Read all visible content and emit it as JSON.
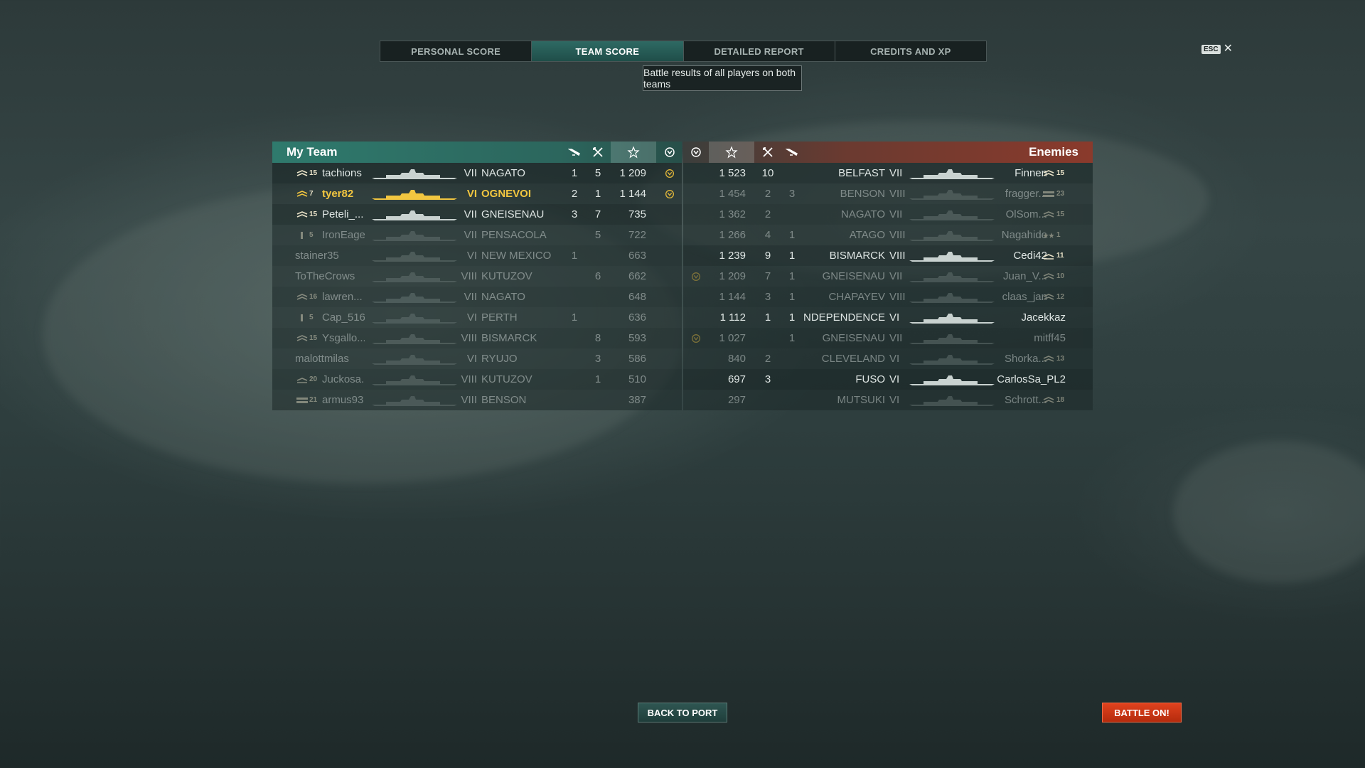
{
  "tabs": [
    {
      "label": "PERSONAL SCORE",
      "active": false
    },
    {
      "label": "TEAM SCORE",
      "active": true
    },
    {
      "label": "DETAILED REPORT",
      "active": false
    },
    {
      "label": "CREDITS AND XP",
      "active": false
    }
  ],
  "tooltip": "Battle results of all players on both teams",
  "esc": {
    "key": "ESC",
    "close": "✕"
  },
  "my_team": {
    "title": "My Team",
    "columns": [
      "plane-kills-icon",
      "ship-kills-icon",
      "star-icon",
      "survived-icon"
    ],
    "rows": [
      {
        "rank": "15",
        "rank_icon": "chevrons-2",
        "name": "tachions",
        "tier": "VII",
        "ship": "NAGATO",
        "planes": "1",
        "kills": "5",
        "xp": "1 209",
        "survived": true,
        "self": false,
        "dead": false
      },
      {
        "rank": "7",
        "rank_icon": "chevrons-2",
        "name": "tyer82",
        "tier": "VI",
        "ship": "OGNEVOI",
        "planes": "2",
        "kills": "1",
        "xp": "1 144",
        "survived": true,
        "self": true,
        "dead": false
      },
      {
        "rank": "15",
        "rank_icon": "chevrons-2",
        "name": "Peteli_...",
        "tier": "VII",
        "ship": "GNEISENAU",
        "planes": "3",
        "kills": "7",
        "xp": "735",
        "survived": false,
        "self": false,
        "dead": false
      },
      {
        "rank": "5",
        "rank_icon": "bar",
        "name": "IronEagel",
        "tier": "VII",
        "ship": "PENSACOLA",
        "planes": "",
        "kills": "5",
        "xp": "722",
        "survived": false,
        "self": false,
        "dead": true
      },
      {
        "rank": "",
        "rank_icon": "",
        "name": "stainer35",
        "tier": "VI",
        "ship": "NEW MEXICO",
        "planes": "1",
        "kills": "",
        "xp": "663",
        "survived": false,
        "self": false,
        "dead": true
      },
      {
        "rank": "",
        "rank_icon": "",
        "name": "ToTheCrows",
        "tier": "VIII",
        "ship": "KUTUZOV",
        "planes": "",
        "kills": "6",
        "xp": "662",
        "survived": false,
        "self": false,
        "dead": true
      },
      {
        "rank": "16",
        "rank_icon": "chevrons-2",
        "name": "lawren...",
        "tier": "VII",
        "ship": "NAGATO",
        "planes": "",
        "kills": "",
        "xp": "648",
        "survived": false,
        "self": false,
        "dead": true
      },
      {
        "rank": "5",
        "rank_icon": "bar",
        "name": "Cap_516",
        "tier": "VI",
        "ship": "PERTH",
        "planes": "1",
        "kills": "",
        "xp": "636",
        "survived": false,
        "self": false,
        "dead": true
      },
      {
        "rank": "15",
        "rank_icon": "chevrons-2",
        "name": "Ysgallo...",
        "tier": "VIII",
        "ship": "BISMARCK",
        "planes": "",
        "kills": "8",
        "xp": "593",
        "survived": false,
        "self": false,
        "dead": true
      },
      {
        "rank": "",
        "rank_icon": "",
        "name": "malottmilas",
        "tier": "VI",
        "ship": "RYUJO",
        "planes": "",
        "kills": "3",
        "xp": "586",
        "survived": false,
        "self": false,
        "dead": true
      },
      {
        "rank": "20",
        "rank_icon": "chevron-1",
        "name": "Juckosa...",
        "tier": "VIII",
        "ship": "KUTUZOV",
        "planes": "",
        "kills": "1",
        "xp": "510",
        "survived": false,
        "self": false,
        "dead": true
      },
      {
        "rank": "21",
        "rank_icon": "bars",
        "name": "armus93",
        "tier": "VIII",
        "ship": "BENSON",
        "planes": "",
        "kills": "",
        "xp": "387",
        "survived": false,
        "self": false,
        "dead": true
      }
    ]
  },
  "enemies": {
    "title": "Enemies",
    "columns": [
      "survived-icon",
      "star-icon",
      "ship-kills-icon",
      "plane-kills-icon"
    ],
    "rows": [
      {
        "survived": false,
        "xp": "1 523",
        "kills": "10",
        "planes": "",
        "ship": "BELFAST",
        "tier": "VII",
        "name": "Finnen",
        "rank": "15",
        "rank_icon": "chevrons-2",
        "dead": false
      },
      {
        "survived": false,
        "xp": "1 454",
        "kills": "2",
        "planes": "3",
        "ship": "BENSON",
        "tier": "VIII",
        "name": "fragger...",
        "rank": "23",
        "rank_icon": "bars",
        "dead": true
      },
      {
        "survived": false,
        "xp": "1 362",
        "kills": "2",
        "planes": "",
        "ship": "NAGATO",
        "tier": "VII",
        "name": "OlSom...",
        "rank": "15",
        "rank_icon": "chevrons-2",
        "dead": true
      },
      {
        "survived": false,
        "xp": "1 266",
        "kills": "4",
        "planes": "1",
        "ship": "ATAGO",
        "tier": "VIII",
        "name": "Nagahide",
        "rank": "1",
        "rank_icon": "stars",
        "dead": true
      },
      {
        "survived": false,
        "xp": "1 239",
        "kills": "9",
        "planes": "1",
        "ship": "BISMARCK",
        "tier": "VIII",
        "name": "Cedi42",
        "rank": "11",
        "rank_icon": "chevron-1",
        "dead": false
      },
      {
        "survived": true,
        "xp": "1 209",
        "kills": "7",
        "planes": "1",
        "ship": "GNEISENAU",
        "tier": "VII",
        "name": "Juan_V...",
        "rank": "10",
        "rank_icon": "chevrons-2",
        "dead": true
      },
      {
        "survived": false,
        "xp": "1 144",
        "kills": "3",
        "planes": "1",
        "ship": "CHAPAYEV",
        "tier": "VIII",
        "name": "claas_jan",
        "rank": "12",
        "rank_icon": "chevrons-2",
        "dead": true
      },
      {
        "survived": false,
        "xp": "1 112",
        "kills": "1",
        "planes": "1",
        "ship": "INDEPENDENCE",
        "tier": "VI",
        "name": "Jacekkaz",
        "rank": "",
        "rank_icon": "",
        "dead": false
      },
      {
        "survived": true,
        "xp": "1 027",
        "kills": "",
        "planes": "1",
        "ship": "GNEISENAU",
        "tier": "VII",
        "name": "mitff45",
        "rank": "",
        "rank_icon": "",
        "dead": true
      },
      {
        "survived": false,
        "xp": "840",
        "kills": "2",
        "planes": "",
        "ship": "CLEVELAND",
        "tier": "VI",
        "name": "Shorka...",
        "rank": "13",
        "rank_icon": "chevrons-2",
        "dead": true
      },
      {
        "survived": false,
        "xp": "697",
        "kills": "3",
        "planes": "",
        "ship": "FUSO",
        "tier": "VI",
        "name": "CarlosSa_PL2",
        "rank": "",
        "rank_icon": "",
        "dead": false
      },
      {
        "survived": false,
        "xp": "297",
        "kills": "",
        "planes": "",
        "ship": "MUTSUKI",
        "tier": "VI",
        "name": "Schrott...",
        "rank": "18",
        "rank_icon": "chevrons-2",
        "dead": true
      }
    ]
  },
  "buttons": {
    "back": "BACK TO PORT",
    "battle": "BATTLE ON!"
  },
  "colors": {
    "my_team": "#2f7a6d",
    "enemies": "#8a3a2c",
    "self_highlight": "#f2c640",
    "battle_button": "#d23a18"
  }
}
